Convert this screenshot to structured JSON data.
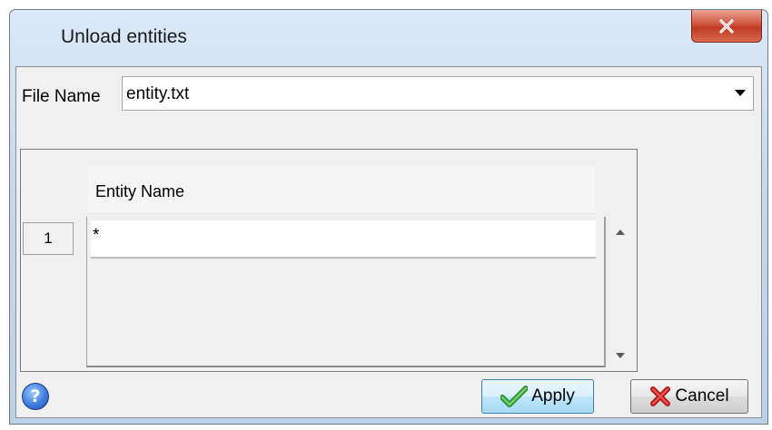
{
  "window": {
    "title": "Unload entities",
    "close_label": "x"
  },
  "file": {
    "label": "File Name",
    "value": "entity.txt"
  },
  "grid": {
    "column_header": "Entity Name",
    "rows": [
      {
        "number": "1",
        "value": "*"
      }
    ]
  },
  "buttons": {
    "help_label": "?",
    "apply_label": "Apply",
    "cancel_label": "Cancel"
  },
  "icons": {
    "close": "close-icon",
    "dropdown": "chevron-down-icon",
    "help": "help-icon",
    "apply": "checkmark-icon",
    "cancel": "red-x-icon",
    "scroll_up": "scroll-up-icon",
    "scroll_down": "scroll-down-icon"
  },
  "colors": {
    "title_gradient_top": "#dce9f7",
    "close_button": "#c13a23",
    "client_background": "#f0f0f0",
    "apply_border": "#3c7fb1",
    "check_green": "#3aa63a",
    "cancel_red": "#d82222"
  }
}
